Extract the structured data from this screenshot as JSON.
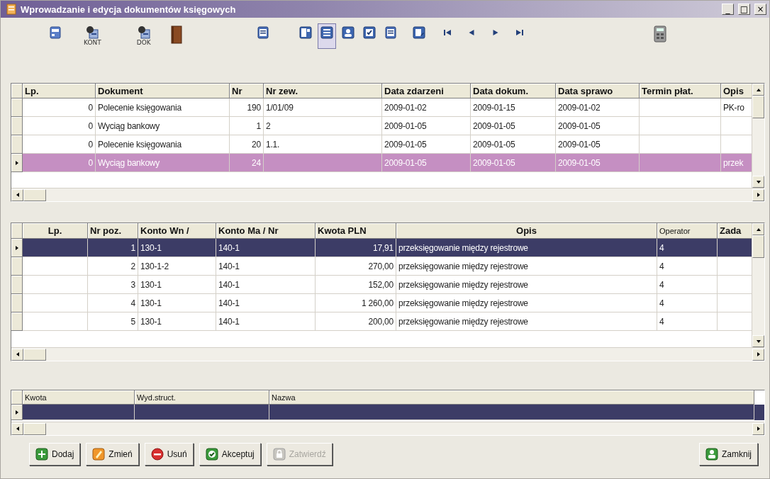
{
  "window": {
    "title": "Wprowadzanie i edycja dokumentów księgowych",
    "controls": [
      "_",
      "□",
      "×"
    ]
  },
  "toolbar": [
    {
      "pressed": false
    },
    {
      "label": "KONT",
      "pressed": false
    },
    {
      "label": "DOK",
      "pressed": false
    },
    {
      "pressed": false
    },
    {
      "pressed": false
    },
    {
      "pressed": false
    },
    {
      "pressed": true
    },
    {
      "pressed": false
    },
    {
      "pressed": false
    },
    {
      "pressed": false
    },
    {
      "pressed": false
    },
    {
      "pressed": false
    },
    {
      "pressed": false
    },
    {
      "pressed": false
    },
    {
      "pressed": false
    },
    {
      "pressed": false
    }
  ],
  "documents": {
    "columns": [
      "Lp.",
      "Dokument",
      "Nr",
      "Nr zew.",
      "Data zdarzeni",
      "Data dokum.",
      "Data sprawo",
      "Termin płat.",
      "Opis"
    ],
    "rows": [
      {
        "selected": false,
        "cells": [
          "0",
          "Polecenie księgowania",
          "190",
          "1/01/09",
          "2009-01-02",
          "2009-01-15",
          "2009-01-02",
          null,
          "PK-ro"
        ]
      },
      {
        "selected": false,
        "cells": [
          "0",
          "Wyciąg bankowy",
          "1",
          "2",
          "2009-01-05",
          "2009-01-05",
          "2009-01-05",
          null,
          null
        ]
      },
      {
        "selected": false,
        "cells": [
          "0",
          "Polecenie księgowania",
          "20",
          "1.1.",
          "2009-01-05",
          "2009-01-05",
          "2009-01-05",
          null,
          null
        ]
      },
      {
        "selected": true,
        "cells": [
          "0",
          "Wyciąg bankowy",
          "24",
          null,
          "2009-01-05",
          "2009-01-05",
          "2009-01-05",
          null,
          "przek"
        ]
      }
    ]
  },
  "entries": {
    "columns": [
      "Lp.",
      "Nr poz.",
      "Konto Wn /",
      "Konto Ma / Nr",
      "Kwota PLN",
      "Opis",
      "Operator",
      "Zada"
    ],
    "rows": [
      {
        "selected": true,
        "cells": [
          null,
          "1",
          "130-1",
          "140-1",
          "17,91",
          "przeksięgowanie między rejestrowe",
          "4",
          null
        ]
      },
      {
        "selected": false,
        "cells": [
          null,
          "2",
          "130-1-2",
          "140-1",
          "270,00",
          "przeksięgowanie między rejestrowe",
          "4",
          null
        ]
      },
      {
        "selected": false,
        "cells": [
          null,
          "3",
          "130-1",
          "140-1",
          "152,00",
          "przeksięgowanie między rejestrowe",
          "4",
          null
        ]
      },
      {
        "selected": false,
        "cells": [
          null,
          "4",
          "130-1",
          "140-1",
          "1 260,00",
          "przeksięgowanie między rejestrowe",
          "4",
          null
        ]
      },
      {
        "selected": false,
        "cells": [
          null,
          "5",
          "130-1",
          "140-1",
          "200,00",
          "przeksięgowanie między rejestrowe",
          "4",
          null
        ]
      }
    ]
  },
  "allocations": {
    "columns": [
      "Kwota",
      "Wyd.struct.",
      "Nazwa"
    ],
    "rows": [
      {
        "selected": true,
        "cells": [
          null,
          null,
          null
        ]
      }
    ]
  },
  "buttons": [
    {
      "label": "Dodaj",
      "disabled": false
    },
    {
      "label": "Zmień",
      "disabled": false
    },
    {
      "label": "Usuń",
      "disabled": false
    },
    {
      "label": "Akceptuj",
      "disabled": false
    },
    {
      "label": "Zatwierdź",
      "disabled": true
    }
  ],
  "close_button": {
    "label": "Zamknij",
    "disabled": false
  }
}
